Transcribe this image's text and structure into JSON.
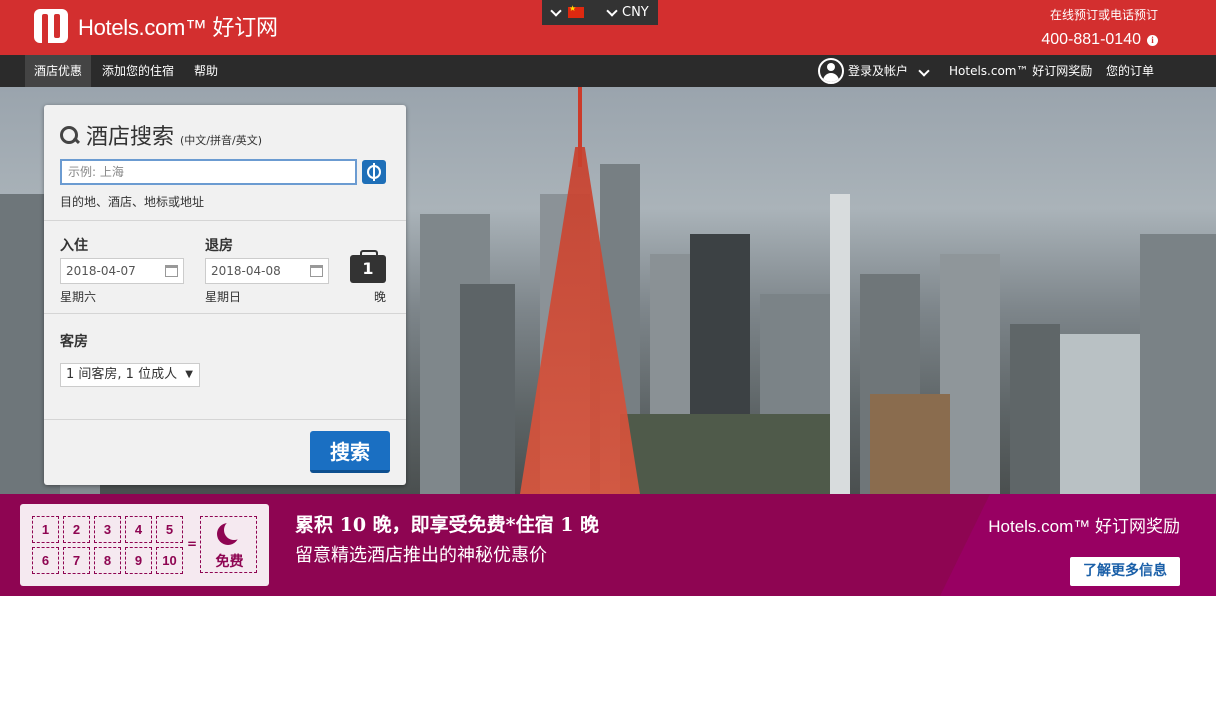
{
  "header": {
    "brand": "Hotels.com™ 好订网",
    "currency": "CNY",
    "phone_label": "在线预订或电话预订",
    "phone_number": "400-881-0140"
  },
  "nav": {
    "items_left": [
      "酒店优惠",
      "添加您的住宿",
      "帮助"
    ],
    "login": "登录及帐户",
    "rewards": "Hotels.com™ 好订网奖励",
    "orders": "您的订单"
  },
  "search": {
    "title": "酒店搜索",
    "subtitle": "(中文/拼音/英文)",
    "placeholder": "示例: 上海",
    "hint": "目的地、酒店、地标或地址",
    "checkin_label": "入住",
    "checkout_label": "退房",
    "checkin_date": "2018-04-07",
    "checkout_date": "2018-04-08",
    "checkin_dow": "星期六",
    "checkout_dow": "星期日",
    "nights": "1",
    "nights_label": "晚",
    "rooms_label": "客房",
    "rooms_value": "1 间客房, 1 位成人",
    "search_button": "搜索"
  },
  "promo": {
    "numbers": [
      "1",
      "2",
      "3",
      "4",
      "5",
      "6",
      "7",
      "8",
      "9",
      "10"
    ],
    "equals": "=",
    "free": "免费",
    "title": "累积 10 晚，即享受免费*住宿 1 晚",
    "subtitle": "留意精选酒店推出的神秘优惠价",
    "brand": "Hotels.com™ 好订网奖励",
    "more_button": "了解更多信息"
  },
  "colors": {
    "brand_red": "#d32f2f",
    "nav_dark": "#2b2b2b",
    "promo_magenta": "#8e0552",
    "button_blue": "#1a6fc2"
  }
}
